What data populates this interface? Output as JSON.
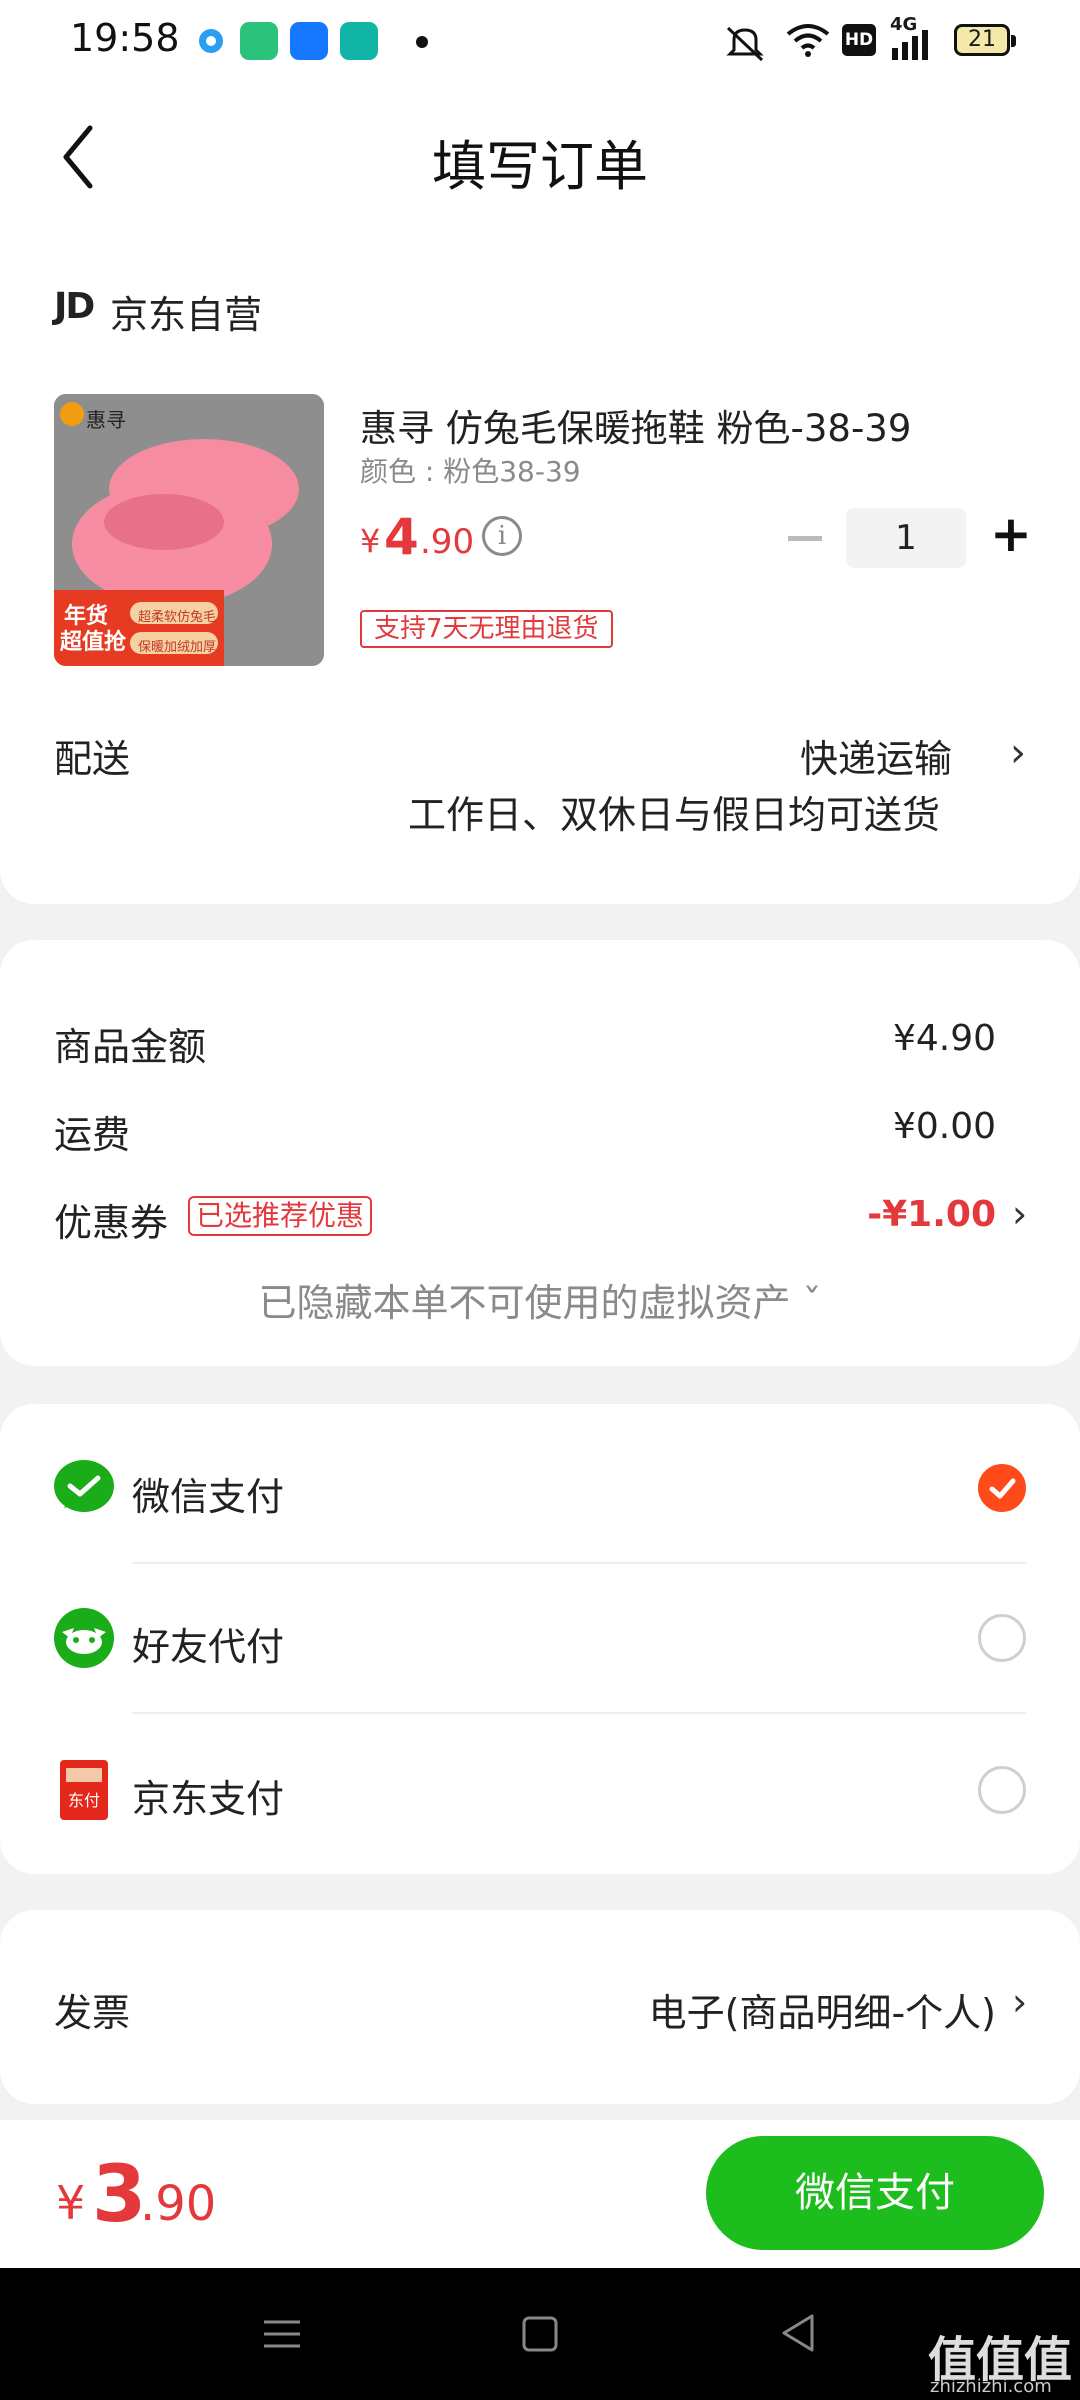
{
  "status_bar": {
    "time": "19:58",
    "network": "4G",
    "battery": "21",
    "hd": "HD"
  },
  "nav": {
    "title": "填写订单"
  },
  "shop": {
    "logo": "JD",
    "name": "京东自营",
    "product": {
      "title": "惠寻 仿兔毛保暖拖鞋 粉色-38-39",
      "spec": "颜色 : 粉色38-39",
      "price_yen": "¥",
      "price_int": "4",
      "price_dec": ".90",
      "quantity": "1",
      "return_tag": "支持7天无理由退货",
      "image_badge": "惠寻",
      "image_promo_1": "年货",
      "image_promo_2": "超值抢",
      "image_promo_3": "超柔软仿兔毛",
      "image_promo_4": "保暖加绒加厚"
    },
    "shipping": {
      "label": "配送",
      "value": "快递运输",
      "note": "工作日、双休日与假日均可送货"
    }
  },
  "amounts": {
    "goods_label": "商品金额",
    "goods_value": "¥4.90",
    "freight_label": "运费",
    "freight_value": "¥0.00",
    "coupon_label": "优惠券",
    "coupon_tag": "已选推荐优惠",
    "coupon_value": "-¥1.00",
    "hidden_note": "已隐藏本单不可使用的虚拟资产 ˇ"
  },
  "payment": {
    "options": [
      {
        "label": "微信支付",
        "icon": "wechat-pay-icon",
        "selected": true
      },
      {
        "label": "好友代付",
        "icon": "friend-pay-icon",
        "selected": false
      },
      {
        "label": "京东支付",
        "icon": "jd-pay-icon",
        "selected": false
      }
    ],
    "jd_pay_icon_text": "东付"
  },
  "invoice": {
    "label": "发票",
    "value": "电子(商品明细-个人)"
  },
  "bottom": {
    "total_yen": "¥",
    "total_int": "3",
    "total_dec": ".90",
    "pay_button": "微信支付"
  },
  "watermark": {
    "text": "值值值",
    "sub": "zhizhizhi.com"
  },
  "colors": {
    "price_red": "#e4393c",
    "pay_green": "#1ebd1e",
    "check_orange": "#ff4a1a",
    "wechat_green": "#1aad19"
  }
}
